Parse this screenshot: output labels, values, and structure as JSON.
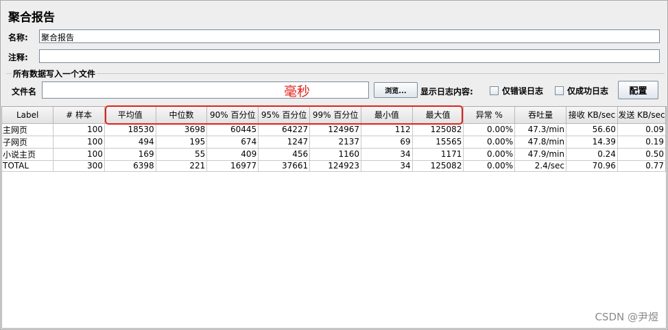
{
  "panel": {
    "title": "聚合报告",
    "name_label": "名称:",
    "name_value": "聚合报告",
    "comment_label": "注释:",
    "comment_value": ""
  },
  "file_group": {
    "title": "所有数据写入一个文件",
    "filename_label": "文件名",
    "filename_value": "",
    "browse_label": "浏览...",
    "log_label": "显示日志内容:",
    "errors_only_label": "仅错误日志",
    "success_only_label": "仅成功日志",
    "configure_label": "配置"
  },
  "annotation": {
    "unit_note": "毫秒",
    "highlight_color": "#e0201a"
  },
  "table": {
    "columns": [
      "Label",
      "# 样本",
      "平均值",
      "中位数",
      "90% 百分位",
      "95% 百分位",
      "99% 百分位",
      "最小值",
      "最大值",
      "异常 %",
      "吞吐量",
      "接收 KB/sec",
      "发送 KB/sec"
    ],
    "rows": [
      [
        "主网页",
        "100",
        "18530",
        "3698",
        "60445",
        "64227",
        "124967",
        "112",
        "125082",
        "0.00%",
        "47.3/min",
        "56.60",
        "0.09"
      ],
      [
        "子网页",
        "100",
        "494",
        "195",
        "674",
        "1247",
        "2137",
        "69",
        "15565",
        "0.00%",
        "47.8/min",
        "14.39",
        "0.19"
      ],
      [
        "小说主页",
        "100",
        "169",
        "55",
        "409",
        "456",
        "1160",
        "34",
        "1171",
        "0.00%",
        "47.9/min",
        "0.24",
        "0.50"
      ],
      [
        "TOTAL",
        "300",
        "6398",
        "221",
        "16977",
        "37661",
        "124923",
        "34",
        "125082",
        "0.00%",
        "2.4/sec",
        "70.96",
        "0.77"
      ]
    ]
  },
  "watermark": "CSDN @尹煜"
}
